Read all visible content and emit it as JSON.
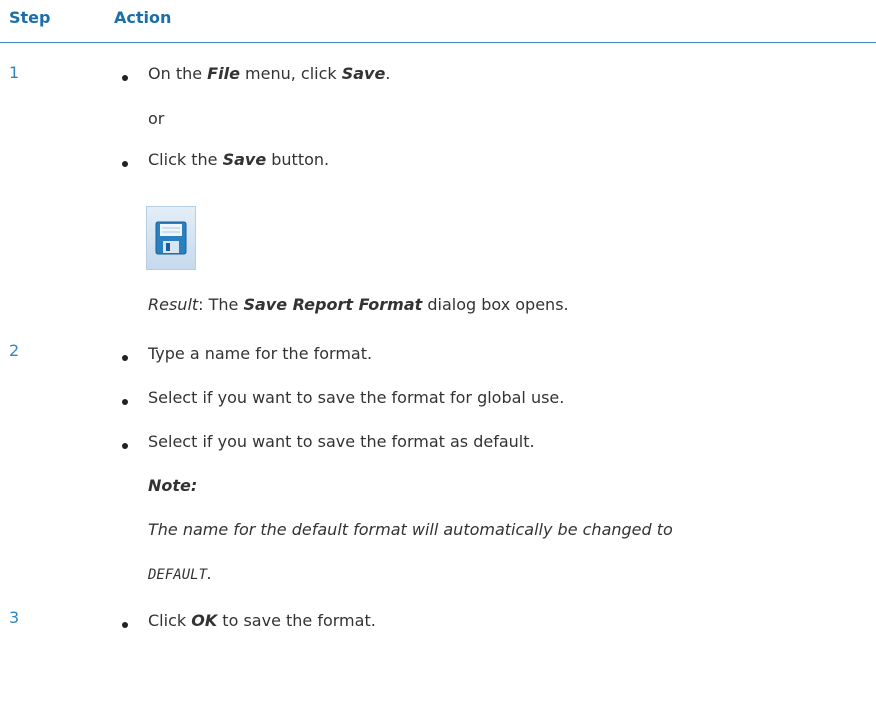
{
  "header": {
    "step": "Step",
    "action": "Action"
  },
  "steps": [
    {
      "number": "1",
      "bullet1": {
        "pre": "On the ",
        "b1": "File",
        "mid": " menu, click ",
        "b2": "Save",
        "post": "."
      },
      "or": "or",
      "bullet2": {
        "pre": "Click the ",
        "b": "Save",
        "post": " button."
      },
      "icon": "save-floppy-icon",
      "result": {
        "label": "Result",
        "colon": ": The ",
        "b": "Save Report Format",
        "post": " dialog box opens."
      }
    },
    {
      "number": "2",
      "bullets": [
        "Type a name for the format.",
        "Select if you want to save the format for global use.",
        "Select if you want to save the format as default."
      ],
      "note_label": "Note:",
      "note_line1": "The name for the default format will automatically be changed to",
      "note_code": "DEFAULT",
      "note_period": "."
    },
    {
      "number": "3",
      "bullet": {
        "pre": "Click ",
        "b": "OK",
        "post": " to save the format."
      }
    }
  ]
}
